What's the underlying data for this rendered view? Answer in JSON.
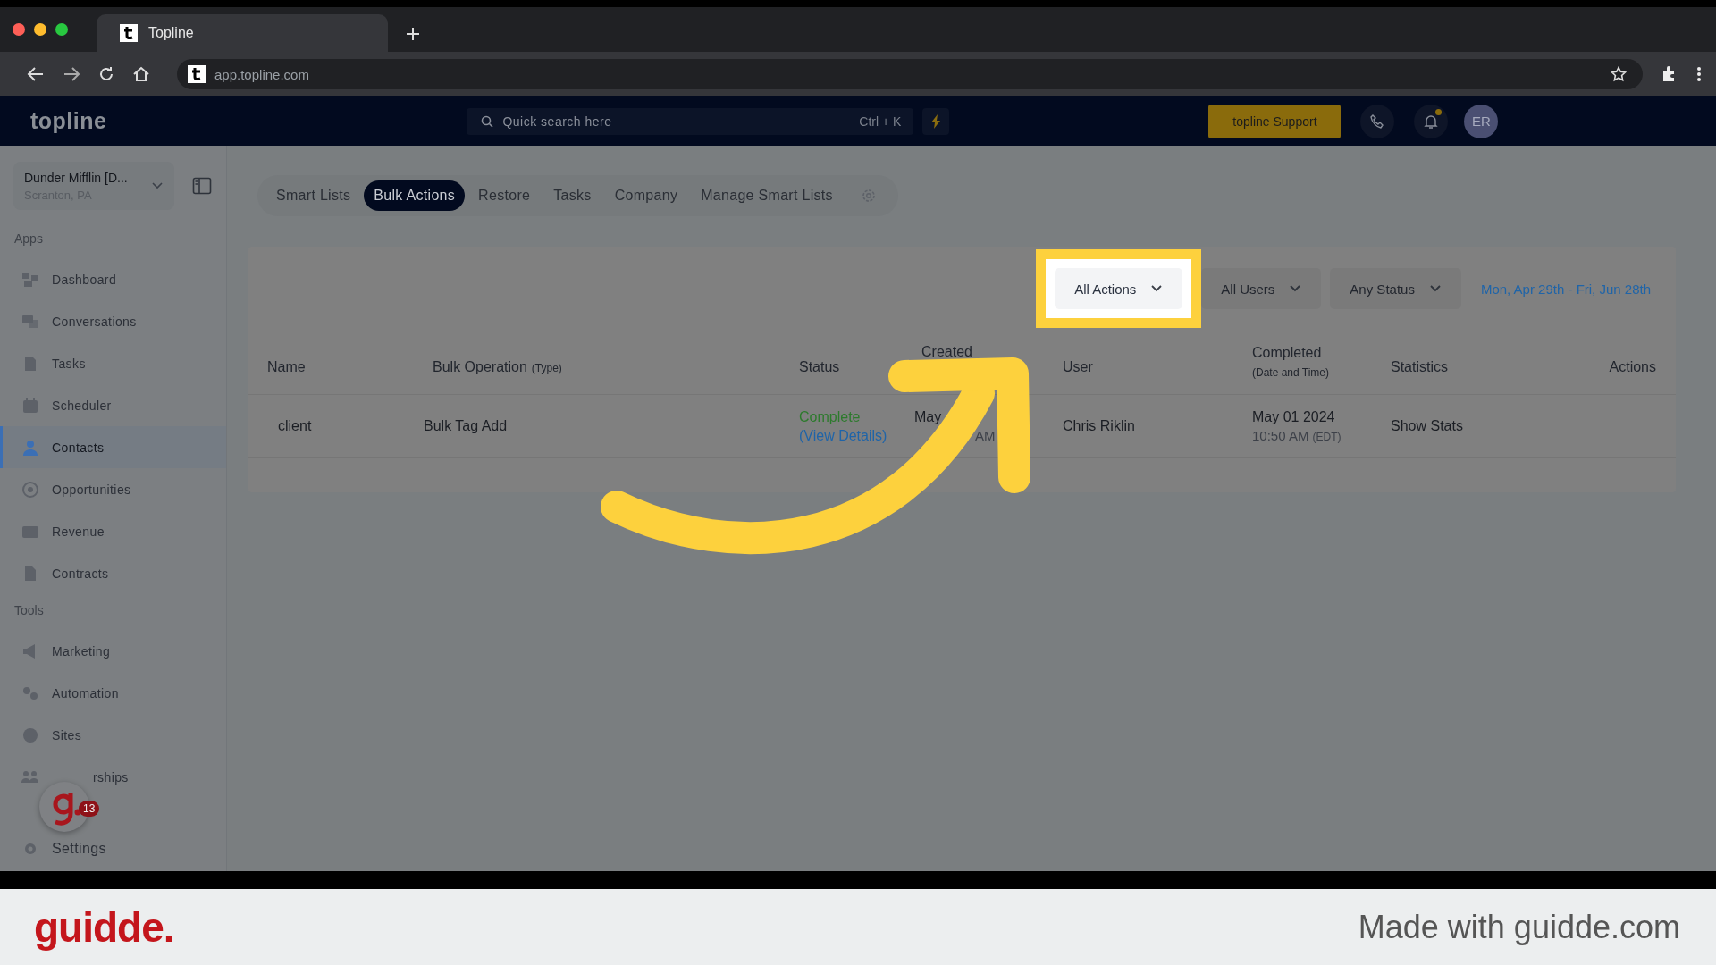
{
  "browser": {
    "tab_title": "Topline",
    "url": "app.topline.com"
  },
  "header": {
    "logo": "topline",
    "search_placeholder": "Quick search here",
    "shortcut": "Ctrl + K",
    "support_button": "topline Support",
    "notification_dot": true,
    "avatar": "ER"
  },
  "sidebar": {
    "account": {
      "name": "Dunder Mifflin [D...",
      "location": "Scranton, PA"
    },
    "sections": [
      {
        "title": "Apps",
        "items": [
          {
            "label": "Dashboard",
            "selected": false
          },
          {
            "label": "Conversations",
            "selected": false
          },
          {
            "label": "Tasks",
            "selected": false
          },
          {
            "label": "Scheduler",
            "selected": false
          },
          {
            "label": "Contacts",
            "selected": true
          },
          {
            "label": "Opportunities",
            "selected": false
          },
          {
            "label": "Revenue",
            "selected": false
          },
          {
            "label": "Contracts",
            "selected": false
          }
        ]
      },
      {
        "title": "Tools",
        "items": [
          {
            "label": "Marketing",
            "selected": false
          },
          {
            "label": "Automation",
            "selected": false
          },
          {
            "label": "Sites",
            "selected": false
          },
          {
            "label": "rships",
            "selected": false
          }
        ]
      }
    ],
    "settings": "Settings",
    "widget_badge": "13"
  },
  "tabs": [
    {
      "label": "Smart Lists",
      "selected": false
    },
    {
      "label": "Bulk Actions",
      "selected": true
    },
    {
      "label": "Restore",
      "selected": false
    },
    {
      "label": "Tasks",
      "selected": false
    },
    {
      "label": "Company",
      "selected": false
    },
    {
      "label": "Manage Smart Lists",
      "selected": false
    }
  ],
  "filters": [
    {
      "label": "All Actions",
      "highlighted": true
    },
    {
      "label": "All Users",
      "highlighted": false
    },
    {
      "label": "Any Status",
      "highlighted": false
    }
  ],
  "date_range": "Mon, Apr 29th - Fri, Jun 28th",
  "table": {
    "columns": [
      {
        "label": "Name"
      },
      {
        "label": "Bulk Operation",
        "note": "(Type)"
      },
      {
        "label": "Status"
      },
      {
        "label": "Created"
      },
      {
        "label": "User"
      },
      {
        "label": "Completed",
        "note": "(Date and Time)"
      },
      {
        "label": "Statistics"
      },
      {
        "label": "Actions"
      }
    ],
    "rows": [
      {
        "name": "client",
        "operation": "Bulk Tag Add",
        "status": "Complete",
        "status_link": "(View Details)",
        "created": "May",
        "created_time": "AM",
        "user": "Chris Riklin",
        "completed": "May 01 2024",
        "completed_time": "10:50 AM",
        "completed_zone": "(EDT)",
        "statistics": "Show Stats"
      }
    ]
  },
  "footer": {
    "logo": "guidde.",
    "tagline": "Made with guidde.com"
  }
}
